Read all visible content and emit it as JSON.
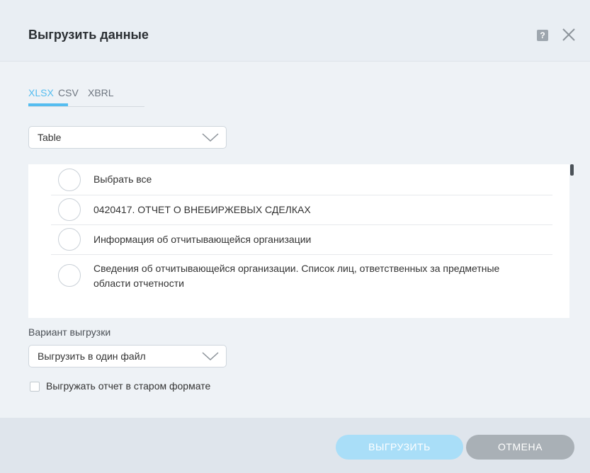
{
  "dialog": {
    "title": "Выгрузить данные",
    "help_icon": "?",
    "close_icon_name": "close-icon"
  },
  "tabs": [
    {
      "label": "XLSX",
      "active": true
    },
    {
      "label": "CSV",
      "active": false
    },
    {
      "label": "XBRL",
      "active": false
    }
  ],
  "table_select": {
    "value": "Table"
  },
  "list_items": [
    {
      "label": "Выбрать все"
    },
    {
      "label": "0420417. ОТЧЕТ О ВНЕБИРЖЕВЫХ СДЕЛКАХ"
    },
    {
      "label": "Информация об отчитывающейся организации"
    },
    {
      "label": "Сведения об отчитывающейся организации. Список лиц, ответственных за предметные области отчетности"
    }
  ],
  "export_variant": {
    "label": "Вариант выгрузки",
    "value": "Выгрузить в один файл"
  },
  "old_format_checkbox": {
    "label": "Выгружать отчет в старом формате",
    "checked": false
  },
  "buttons": {
    "export": "ВЫГРУЗИТЬ",
    "cancel": "ОТМЕНА"
  },
  "colors": {
    "accent": "#55bdf0",
    "primary_button": "#a9def8",
    "cancel_button": "#a9b0b6"
  }
}
